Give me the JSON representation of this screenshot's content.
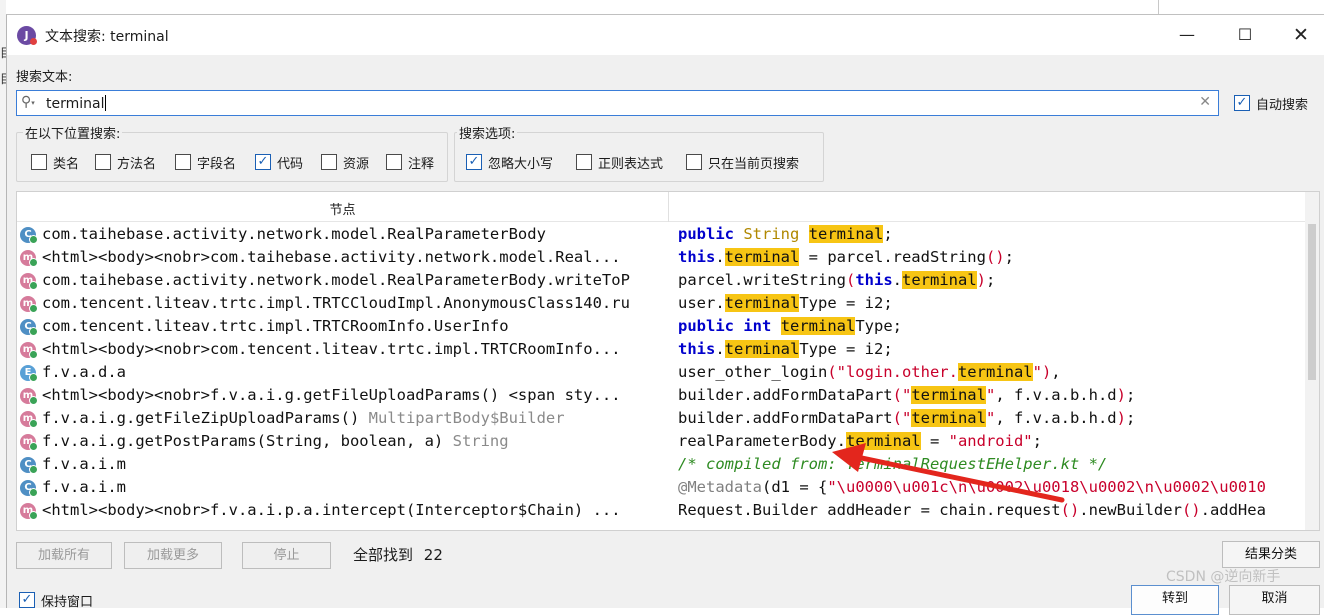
{
  "window": {
    "title": "文本搜索: terminal",
    "left_edge_glyphs": [
      "目",
      "目"
    ]
  },
  "search": {
    "label": "搜索文本:",
    "value": "terminal",
    "auto_search": {
      "label": "自动搜索",
      "checked": true
    }
  },
  "scope": {
    "label": "在以下位置搜索:",
    "options": [
      {
        "label": "类名",
        "checked": false
      },
      {
        "label": "方法名",
        "checked": false
      },
      {
        "label": "字段名",
        "checked": false
      },
      {
        "label": "代码",
        "checked": true
      },
      {
        "label": "资源",
        "checked": false
      },
      {
        "label": "注释",
        "checked": false
      }
    ]
  },
  "search_options": {
    "label": "搜索选项:",
    "options": [
      {
        "label": "忽略大小写",
        "checked": true
      },
      {
        "label": "正则表达式",
        "checked": false
      },
      {
        "label": "只在当前页搜索",
        "checked": false
      }
    ]
  },
  "results": {
    "header_node": "节点",
    "rows": [
      {
        "icon": "C",
        "icon_kind": "c",
        "node": "com.taihebase.activity.network.model.RealParameterBody",
        "node_dim": "",
        "code": [
          {
            "t": "public",
            "c": "kw"
          },
          {
            "t": " "
          },
          {
            "t": "String",
            "c": "ty"
          },
          {
            "t": " "
          },
          {
            "t": "terminal",
            "c": "hl"
          },
          {
            "t": ";"
          }
        ]
      },
      {
        "icon": "m",
        "icon_kind": "m",
        "node": "<html><body><nobr>com.taihebase.activity.network.model.Real...",
        "node_dim": "",
        "code": [
          {
            "t": "this",
            "c": "kw"
          },
          {
            "t": "."
          },
          {
            "t": "terminal",
            "c": "hl"
          },
          {
            "t": " = parcel.readString"
          },
          {
            "t": "()",
            "c": "str"
          },
          {
            "t": ";"
          }
        ]
      },
      {
        "icon": "m",
        "icon_kind": "m",
        "node": "com.taihebase.activity.network.model.RealParameterBody.writeToP",
        "node_dim": "",
        "code": [
          {
            "t": "parcel.writeString"
          },
          {
            "t": "(",
            "c": "str"
          },
          {
            "t": "this",
            "c": "kw"
          },
          {
            "t": "."
          },
          {
            "t": "terminal",
            "c": "hl"
          },
          {
            "t": ")",
            "c": "str"
          },
          {
            "t": ";"
          }
        ]
      },
      {
        "icon": "m",
        "icon_kind": "m",
        "node": "com.tencent.liteav.trtc.impl.TRTCCloudImpl.AnonymousClass140.ru",
        "node_dim": "",
        "code": [
          {
            "t": "user."
          },
          {
            "t": "terminal",
            "c": "hl"
          },
          {
            "t": "Type = i2;"
          }
        ]
      },
      {
        "icon": "C",
        "icon_kind": "c",
        "node": "com.tencent.liteav.trtc.impl.TRTCRoomInfo.UserInfo",
        "node_dim": "",
        "code": [
          {
            "t": "public",
            "c": "kw"
          },
          {
            "t": " "
          },
          {
            "t": "int",
            "c": "kw"
          },
          {
            "t": " "
          },
          {
            "t": "terminal",
            "c": "hl"
          },
          {
            "t": "Type;"
          }
        ]
      },
      {
        "icon": "m",
        "icon_kind": "m",
        "node": "<html><body><nobr>com.tencent.liteav.trtc.impl.TRTCRoomInfo...",
        "node_dim": "",
        "code": [
          {
            "t": "this",
            "c": "kw"
          },
          {
            "t": "."
          },
          {
            "t": "terminal",
            "c": "hl"
          },
          {
            "t": "Type = i2;"
          }
        ]
      },
      {
        "icon": "E",
        "icon_kind": "e",
        "node": "f.v.a.d.a",
        "node_dim": "",
        "code": [
          {
            "t": "user_other_login"
          },
          {
            "t": "(\"login.other.",
            "c": "str"
          },
          {
            "t": "terminal",
            "c": "hl"
          },
          {
            "t": "\")",
            "c": "str"
          },
          {
            "t": ","
          }
        ]
      },
      {
        "icon": "m",
        "icon_kind": "m",
        "node": "<html><body><nobr>f.v.a.i.g.getFileUploadParams() <span sty...",
        "node_dim": "",
        "code": [
          {
            "t": "builder.addFormDataPart"
          },
          {
            "t": "(\"",
            "c": "str"
          },
          {
            "t": "terminal",
            "c": "hl"
          },
          {
            "t": "\"",
            "c": "str"
          },
          {
            "t": ", f.v.a.b.h.d"
          },
          {
            "t": ")",
            "c": "str"
          },
          {
            "t": ";"
          }
        ]
      },
      {
        "icon": "m",
        "icon_kind": "m",
        "node": "f.v.a.i.g.getFileZipUploadParams() ",
        "node_dim": "MultipartBody$Builder",
        "code": [
          {
            "t": "builder.addFormDataPart"
          },
          {
            "t": "(\"",
            "c": "str"
          },
          {
            "t": "terminal",
            "c": "hl"
          },
          {
            "t": "\"",
            "c": "str"
          },
          {
            "t": ", f.v.a.b.h.d"
          },
          {
            "t": ")",
            "c": "str"
          },
          {
            "t": ";"
          }
        ]
      },
      {
        "icon": "m",
        "icon_kind": "m",
        "node": "f.v.a.i.g.getPostParams(String, boolean, a) ",
        "node_dim": "String",
        "code": [
          {
            "t": "realParameterBody."
          },
          {
            "t": "terminal",
            "c": "hl"
          },
          {
            "t": " = "
          },
          {
            "t": "\"android\"",
            "c": "str"
          },
          {
            "t": ";"
          }
        ]
      },
      {
        "icon": "C",
        "icon_kind": "c",
        "node": "f.v.a.i.m",
        "node_dim": "",
        "code": [
          {
            "t": "/* compiled from: TerminalRequestEHelper.kt */",
            "c": "cm"
          }
        ]
      },
      {
        "icon": "C",
        "icon_kind": "c",
        "node": "f.v.a.i.m",
        "node_dim": "",
        "code": [
          {
            "t": "@Metadata",
            "c": "mut"
          },
          {
            "t": "(d1 = {"
          },
          {
            "t": "\"\\u0000\\u001c\\n\\u0002\\u0018\\u0002\\n\\u0002\\u0010",
            "c": "str"
          }
        ]
      },
      {
        "icon": "m",
        "icon_kind": "m",
        "node": "<html><body><nobr>f.v.a.i.p.a.intercept(Interceptor$Chain) ...",
        "node_dim": "",
        "code": [
          {
            "t": "Request.Builder addHeader = chain.request"
          },
          {
            "t": "()",
            "c": "str"
          },
          {
            "t": ".newBuilder"
          },
          {
            "t": "()",
            "c": "str"
          },
          {
            "t": ".addHea"
          }
        ]
      }
    ]
  },
  "actions": {
    "load_all": "加载所有",
    "load_more": "加载更多",
    "stop": "停止",
    "found_label": "全部找到",
    "found_count": "22",
    "group_results": "结果分类",
    "keep_window": {
      "label": "保持窗口",
      "checked": true
    },
    "goto": "转到",
    "cancel": "取消"
  },
  "watermark": "CSDN @逆向新手",
  "colors": {
    "highlight": "#f7c514",
    "keyword": "#0000cc",
    "string": "#c8002b",
    "comment": "#2e8b22",
    "accent": "#1a5fb4",
    "annotation_arrow": "#e3261d"
  }
}
